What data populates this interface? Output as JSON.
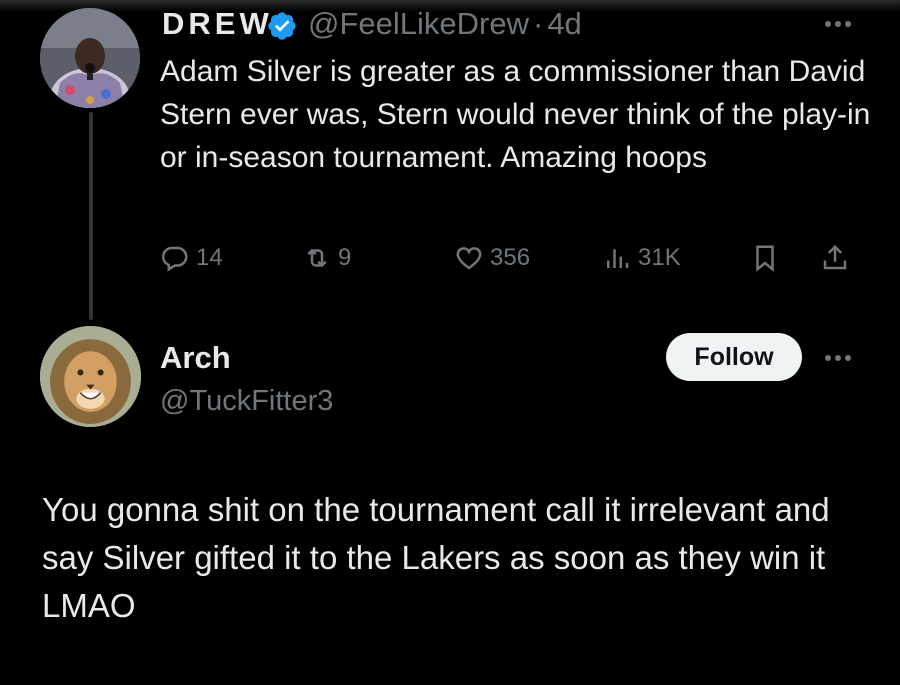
{
  "parent_tweet": {
    "display_name": "DREW",
    "handle": "@FeelLikeDrew",
    "separator": "·",
    "time": "4d",
    "text": "Adam Silver is greater as a commissioner than David Stern ever was, Stern would never think of the play-in or in-season tournament. Amazing hoops",
    "stats": {
      "replies": "14",
      "reposts": "9",
      "likes": "356",
      "views": "31K"
    }
  },
  "reply": {
    "display_name": "Arch",
    "handle": "@TuckFitter3",
    "follow_label": "Follow",
    "text": "You gonna shit on the tournament call it irrelevant and say Silver gifted it to the Lakers as soon as they win it LMAO"
  },
  "colors": {
    "background": "#000000",
    "text": "#e7e9ea",
    "secondary": "#71767b",
    "verified": "#1d9bf0",
    "follow_bg": "#eff3f4"
  },
  "icons": {
    "verified": "verified-badge-icon",
    "reply": "reply-bubble-icon",
    "repost": "repost-arrows-icon",
    "like": "heart-icon",
    "views": "bar-chart-icon",
    "bookmark": "bookmark-icon",
    "share": "share-upload-icon",
    "more": "more-dots-icon"
  }
}
